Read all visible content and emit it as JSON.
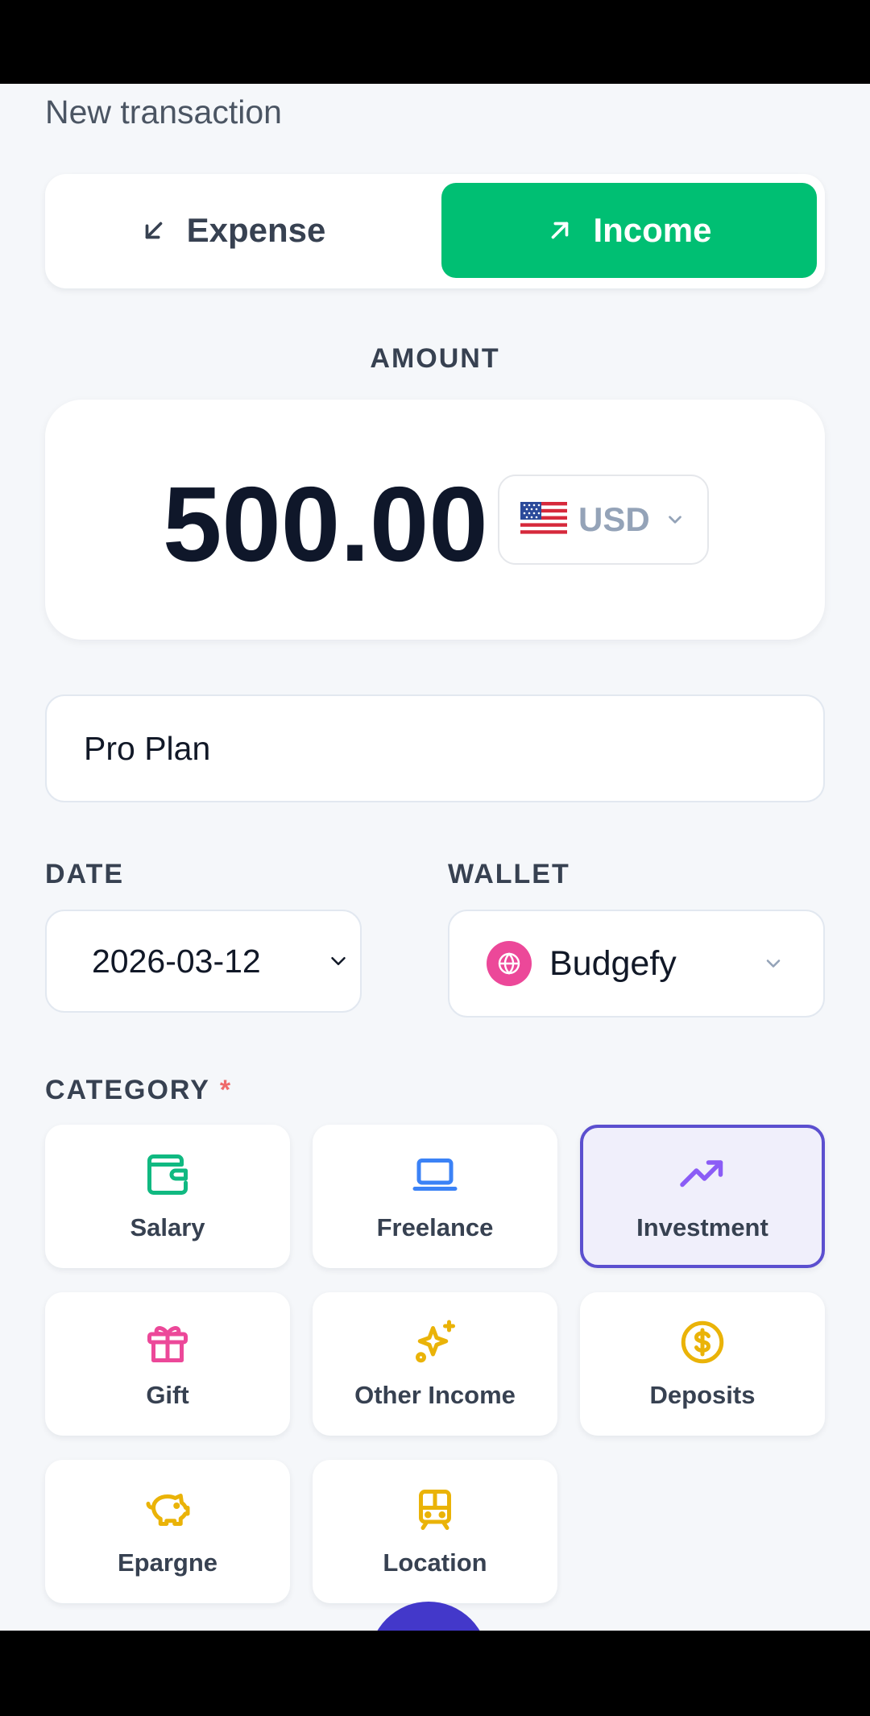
{
  "page": {
    "title": "New transaction"
  },
  "type_toggle": {
    "expense_label": "Expense",
    "income_label": "Income",
    "selected": "Income"
  },
  "amount": {
    "label": "AMOUNT",
    "value": "500.00",
    "currency_code": "USD",
    "currency_flag": "us-flag"
  },
  "description": {
    "value": "Pro Plan"
  },
  "date": {
    "label": "DATE",
    "value": "2026-03-12"
  },
  "wallet": {
    "label": "WALLET",
    "value": "Budgefy",
    "icon": "globe-icon"
  },
  "category": {
    "label": "CATEGORY",
    "required_mark": "*",
    "selected": "Investment",
    "items": [
      {
        "label": "Salary",
        "icon": "wallet-icon",
        "color": "#10b981"
      },
      {
        "label": "Freelance",
        "icon": "laptop-icon",
        "color": "#3b82f6"
      },
      {
        "label": "Investment",
        "icon": "trending-up-icon",
        "color": "#8b5cf6"
      },
      {
        "label": "Gift",
        "icon": "gift-icon",
        "color": "#ec4899"
      },
      {
        "label": "Other Income",
        "icon": "sparkles-icon",
        "color": "#eab308"
      },
      {
        "label": "Deposits",
        "icon": "dollar-circle-icon",
        "color": "#eab308"
      },
      {
        "label": "Epargne",
        "icon": "piggy-bank-icon",
        "color": "#eab308"
      },
      {
        "label": "Location",
        "icon": "train-icon",
        "color": "#eab308"
      }
    ]
  },
  "colors": {
    "income_green": "#00bf73",
    "selected_border": "#5b4fcf",
    "fab": "#4338ca",
    "wallet_dot": "#ec4899"
  }
}
